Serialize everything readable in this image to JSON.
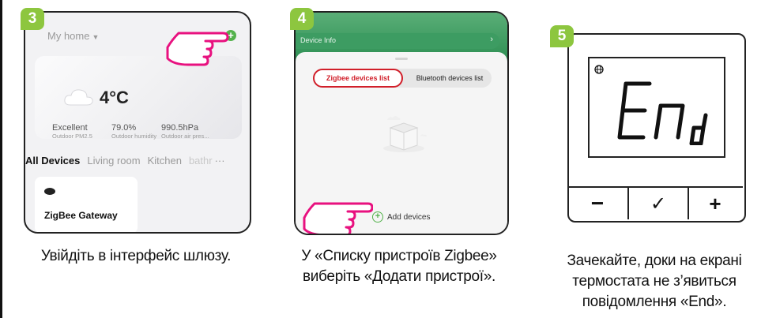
{
  "steps": [
    {
      "number": "3",
      "home_label": "My home",
      "add_icon": "plus-circle-icon",
      "weather": {
        "temperature": "4°C",
        "stats": [
          {
            "value": "Excellent",
            "label": "Outdoor PM2.5"
          },
          {
            "value": "79.0%",
            "label": "Outdoor humidity"
          },
          {
            "value": "990.5hPa",
            "label": "Outdoor air pres..."
          }
        ]
      },
      "tabs": [
        "All Devices",
        "Living room",
        "Kitchen",
        "bathr",
        "···"
      ],
      "device_name": "ZigBee Gateway",
      "caption": "Увійдіть в інтерфейс шлюзу."
    },
    {
      "number": "4",
      "header_label": "Device Info",
      "tab_zigbee": "Zigbee devices list",
      "tab_bluetooth": "Bluetooth devices list",
      "add_label": "Add devices",
      "caption_lines": [
        "У «Списку пристроїв Zigbee»",
        "виберіть «Додати пристрої»."
      ]
    },
    {
      "number": "5",
      "display_text": "End",
      "buttons": [
        "−",
        "✓",
        "+"
      ],
      "caption_lines": [
        "Зачекайте, доки на екрані",
        "термостата не з’явиться",
        "повідомлення «End»."
      ]
    }
  ],
  "colors": {
    "accent_green": "#8dc63f",
    "app_green": "#54b24c",
    "highlight_red": "#d11f2a"
  }
}
